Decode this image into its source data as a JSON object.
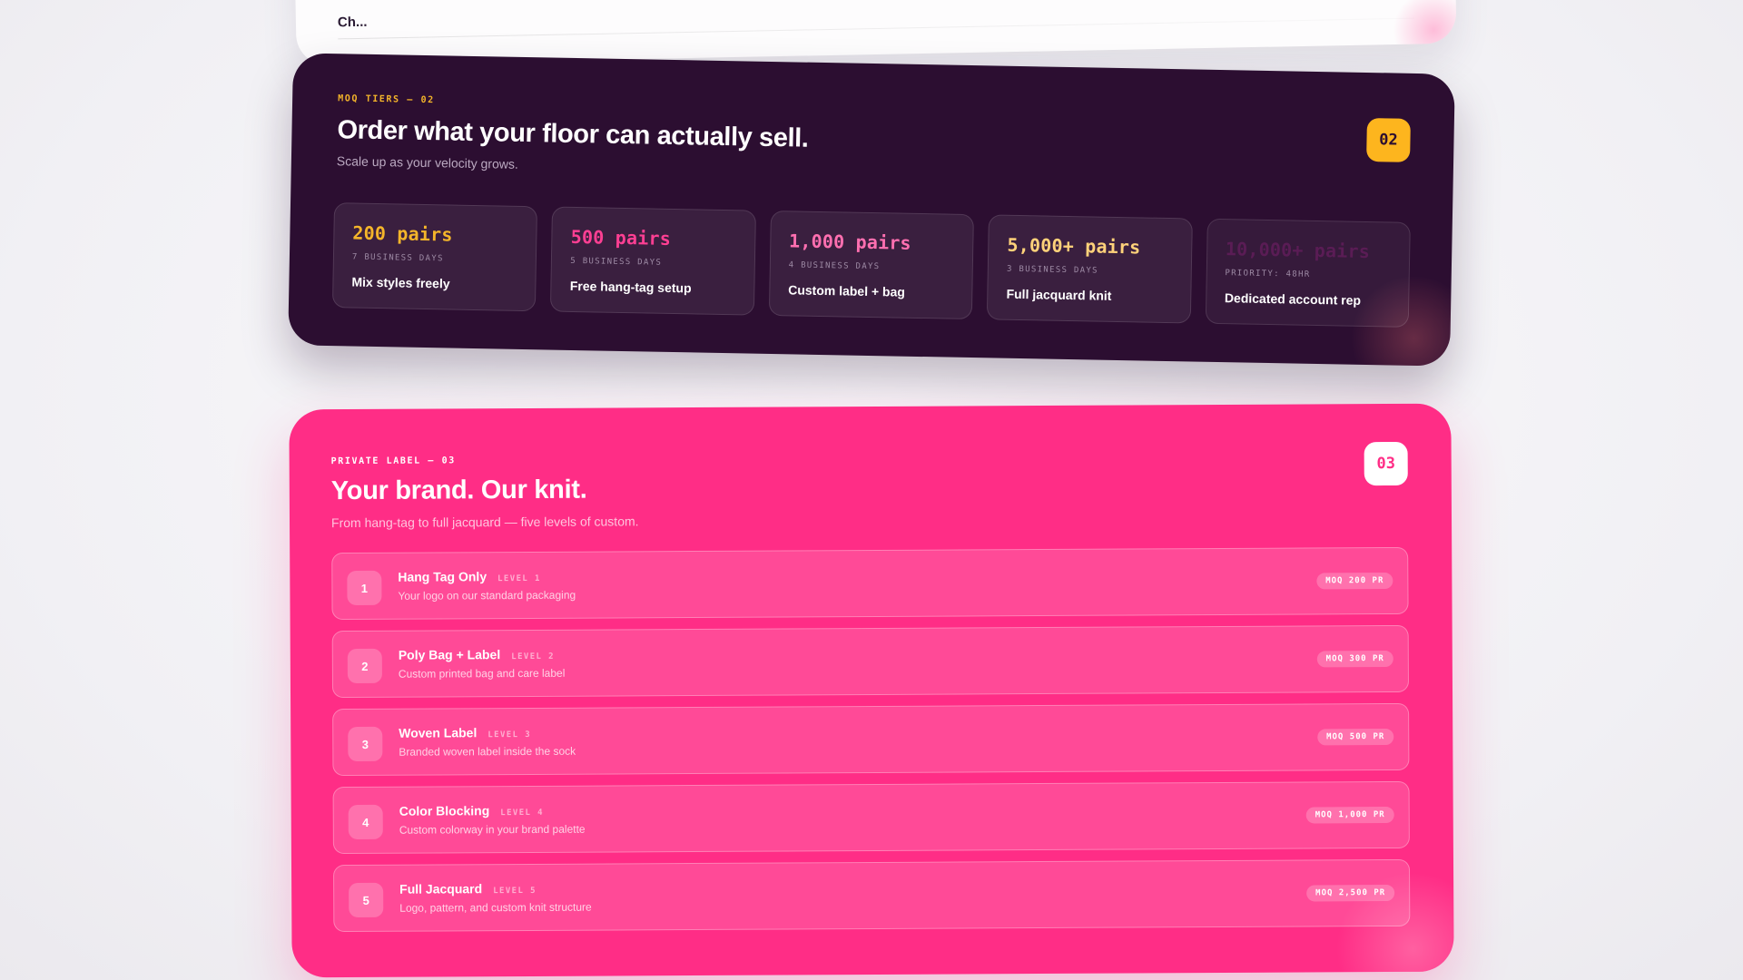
{
  "top_card": {
    "cut_text": "Ch..."
  },
  "moq": {
    "eyebrow": "MOQ TIERS — 02",
    "title": "Order what your floor can actually sell.",
    "subtitle": "Scale up as your velocity grows.",
    "badge": "02",
    "tiers": [
      {
        "amount": "200 pairs",
        "lead": "7 BUSINESS DAYS",
        "perk": "Mix styles freely",
        "color": "#f4b52a"
      },
      {
        "amount": "500 pairs",
        "lead": "5 BUSINESS DAYS",
        "perk": "Free hang-tag setup",
        "color": "#ff3f93"
      },
      {
        "amount": "1,000 pairs",
        "lead": "4 BUSINESS DAYS",
        "perk": "Custom label + bag",
        "color": "#ff6fb0"
      },
      {
        "amount": "5,000+ pairs",
        "lead": "3 BUSINESS DAYS",
        "perk": "Full jacquard knit",
        "color": "#ffd27a"
      },
      {
        "amount": "10,000+ pairs",
        "lead": "PRIORITY: 48HR",
        "perk": "Dedicated account rep",
        "color": "#5a1c55"
      }
    ]
  },
  "private_label": {
    "eyebrow": "PRIVATE LABEL — 03",
    "title": "Your brand. Our knit.",
    "subtitle": "From hang-tag to full jacquard — five levels of custom.",
    "badge": "03",
    "levels": [
      {
        "index": "1",
        "name": "Hang Tag Only",
        "level": "LEVEL 1",
        "desc": "Your logo on our standard packaging",
        "moq": "MOQ 200 PR"
      },
      {
        "index": "2",
        "name": "Poly Bag + Label",
        "level": "LEVEL 2",
        "desc": "Custom printed bag and care label",
        "moq": "MOQ 300 PR"
      },
      {
        "index": "3",
        "name": "Woven Label",
        "level": "LEVEL 3",
        "desc": "Branded woven label inside the sock",
        "moq": "MOQ 500 PR"
      },
      {
        "index": "4",
        "name": "Color Blocking",
        "level": "LEVEL 4",
        "desc": "Custom colorway in your brand palette",
        "moq": "MOQ 1,000 PR"
      },
      {
        "index": "5",
        "name": "Full Jacquard",
        "level": "LEVEL 5",
        "desc": "Logo, pattern, and custom knit structure",
        "moq": "MOQ 2,500 PR"
      }
    ]
  },
  "colors": {
    "dark": "#2c0e31",
    "pink": "#ff2d86",
    "amber": "#fdb51e"
  }
}
